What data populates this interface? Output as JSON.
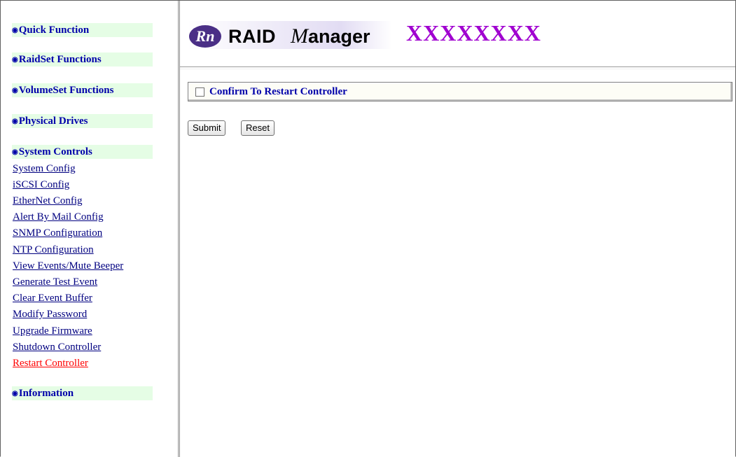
{
  "sidebar": {
    "sections": [
      {
        "label": "Quick Function"
      },
      {
        "label": "RaidSet Functions"
      },
      {
        "label": "VolumeSet Functions"
      },
      {
        "label": "Physical Drives"
      },
      {
        "label": "System Controls"
      },
      {
        "label": "Information"
      }
    ],
    "links": [
      {
        "label": "System Config"
      },
      {
        "label": "iSCSI Config"
      },
      {
        "label": "EtherNet Config"
      },
      {
        "label": "Alert By Mail Config"
      },
      {
        "label": "SNMP Configuration"
      },
      {
        "label": "NTP Configuration"
      },
      {
        "label": "View Events/Mute Beeper"
      },
      {
        "label": "Generate Test Event"
      },
      {
        "label": "Clear Event Buffer"
      },
      {
        "label": "Modify Password"
      },
      {
        "label": "Upgrade Firmware"
      },
      {
        "label": "Shutdown Controller"
      },
      {
        "label": "Restart Controller",
        "active": true
      }
    ]
  },
  "header": {
    "logo_mark": "Rn",
    "logo_text_raid": "RAID",
    "logo_text_m": "M",
    "logo_text_anager": "anager",
    "model": "XXXXXXXX"
  },
  "main": {
    "confirm_label": "Confirm To Restart Controller",
    "confirm_checked": false,
    "submit_label": "Submit",
    "reset_label": "Reset"
  },
  "colors": {
    "section_bg": "#e5fde5",
    "section_text": "#0000aa",
    "link": "#000080",
    "active_link": "#ff0000",
    "model_text": "#a000d0"
  }
}
